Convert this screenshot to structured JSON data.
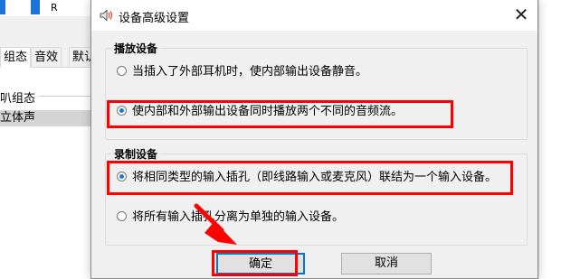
{
  "background": {
    "channel_label": "R",
    "tabs": [
      "组态",
      "音效",
      "默认"
    ],
    "group_label": "叭组态",
    "selected_item": "立体声"
  },
  "dialog": {
    "title": "设备高级设置",
    "close_glyph": "✕",
    "playback": {
      "title": "播放设备",
      "options": [
        {
          "label": "当插入了外部耳机时，使内部输出设备静音。",
          "selected": false
        },
        {
          "label": "使内部和外部输出设备同时播放两个不同的音频流。",
          "selected": true
        }
      ]
    },
    "recording": {
      "title": "录制设备",
      "options": [
        {
          "label": "将相同类型的输入插孔（即线路输入或麦克风）联结为一个输入设备。",
          "selected": true
        },
        {
          "label": "将所有输入插孔分离为单独的输入设备。",
          "selected": false
        }
      ]
    },
    "ok_label": "确定",
    "cancel_label": "取消"
  },
  "colors": {
    "highlight": "#ff0000",
    "accent": "#0078d7",
    "radio_dot": "#1f75d6"
  }
}
